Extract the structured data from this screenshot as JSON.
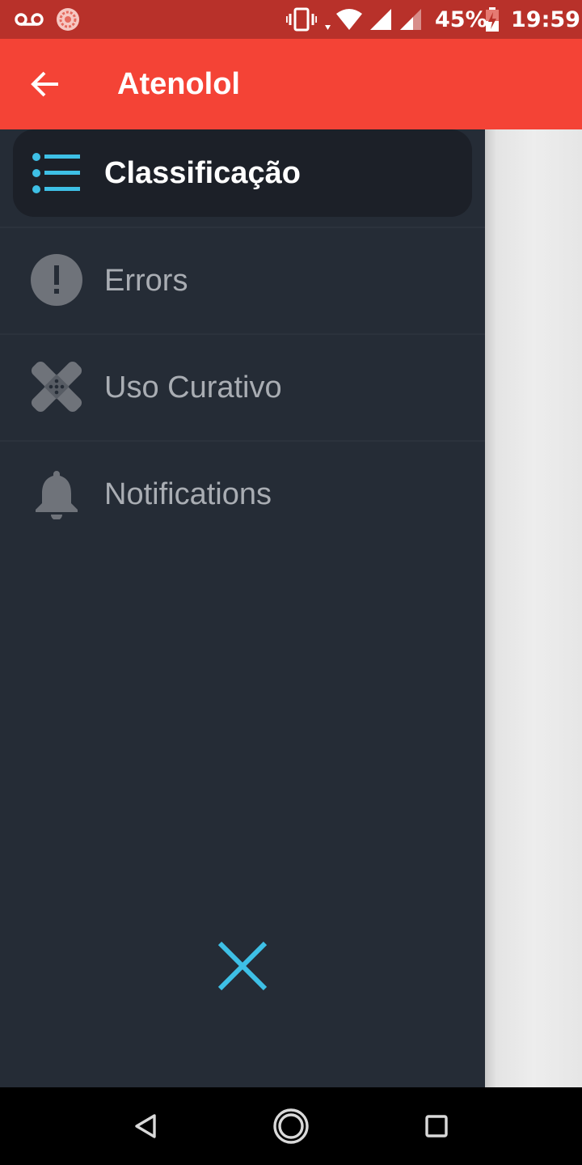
{
  "status_bar": {
    "battery": "45%",
    "time": "19:59",
    "icons": [
      "voicemail-icon",
      "notification-app-icon",
      "vibrate-icon",
      "wifi-icon",
      "signal-icon",
      "signal-icon",
      "battery-charging-icon"
    ]
  },
  "app_bar": {
    "title": "Atenolol",
    "back_icon": "arrow-back-icon",
    "background_color": "#f44336"
  },
  "drawer": {
    "items": [
      {
        "label": "Classificação",
        "icon": "list-icon",
        "selected": true
      },
      {
        "label": "Errors",
        "icon": "error-icon",
        "selected": false
      },
      {
        "label": "Uso Curativo",
        "icon": "bandage-icon",
        "selected": false
      },
      {
        "label": "Notifications",
        "icon": "bell-icon",
        "selected": false
      }
    ],
    "close_icon": "close-icon",
    "accent_color": "#3ec0e6",
    "background_color": "#252c36"
  },
  "nav_bar": {
    "icons": [
      "back-triangle-icon",
      "home-circle-icon",
      "recents-square-icon"
    ]
  }
}
